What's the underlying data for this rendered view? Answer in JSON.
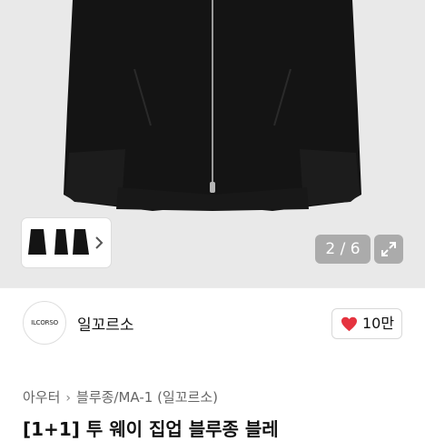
{
  "gallery": {
    "page_counter": "2 / 6",
    "current_page": 2,
    "total_pages": 6,
    "thumbnail_count": 3,
    "background_color": "#e9e9e9",
    "garment_color": "#141414",
    "icons": {
      "thumb_next": "chevron-right-icon",
      "expand": "expand-icon"
    }
  },
  "brand": {
    "avatar_text": "ILCORSO",
    "name": "일꼬르소"
  },
  "like": {
    "count_label": "10만",
    "heart_color": "#e5333f",
    "icon": "heart-icon"
  },
  "breadcrumb": {
    "items": [
      "아우터",
      "블루종/MA-1 (일꼬르소)"
    ],
    "separator_icon": "chevron-right-icon"
  },
  "product": {
    "title": "[1+1] 투 웨이 집업 블루종 블레"
  }
}
